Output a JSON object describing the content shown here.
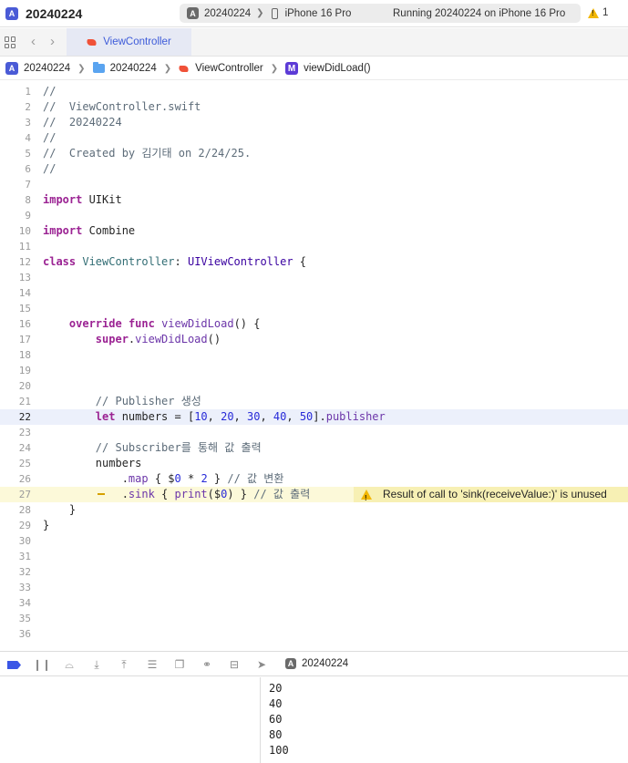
{
  "window": {
    "title": "20240224",
    "scheme": "20240224",
    "device": "iPhone 16 Pro",
    "status": "Running 20240224 on iPhone 16 Pro",
    "warning_count": "1"
  },
  "tabbar": {
    "back_glyph": "‹",
    "forward_glyph": "›",
    "active_tab": "ViewController"
  },
  "breadcrumb": {
    "project": "20240224",
    "group": "20240224",
    "file": "ViewController",
    "symbol": "viewDidLoad()",
    "symbol_badge": "M",
    "separator": "❯"
  },
  "editor": {
    "current_line": 22,
    "warning_line": 27,
    "warning_message": "Result of call to 'sink(receiveValue:)' is unused",
    "lines": [
      {
        "n": "1",
        "text": "//"
      },
      {
        "n": "2",
        "text": "//  ViewController.swift"
      },
      {
        "n": "3",
        "text": "//  20240224"
      },
      {
        "n": "4",
        "text": "//"
      },
      {
        "n": "5",
        "text": "//  Created by 김기태 on 2/24/25."
      },
      {
        "n": "6",
        "text": "//"
      },
      {
        "n": "7",
        "text": ""
      },
      {
        "n": "8",
        "text": "import UIKit"
      },
      {
        "n": "9",
        "text": ""
      },
      {
        "n": "10",
        "text": "import Combine"
      },
      {
        "n": "11",
        "text": ""
      },
      {
        "n": "12",
        "text": "class ViewController: UIViewController {"
      },
      {
        "n": "13",
        "text": ""
      },
      {
        "n": "14",
        "text": ""
      },
      {
        "n": "15",
        "text": ""
      },
      {
        "n": "16",
        "text": "    override func viewDidLoad() {"
      },
      {
        "n": "17",
        "text": "        super.viewDidLoad()"
      },
      {
        "n": "18",
        "text": ""
      },
      {
        "n": "19",
        "text": ""
      },
      {
        "n": "20",
        "text": ""
      },
      {
        "n": "21",
        "text": "        // Publisher 생성"
      },
      {
        "n": "22",
        "text": "        let numbers = [10, 20, 30, 40, 50].publisher"
      },
      {
        "n": "23",
        "text": ""
      },
      {
        "n": "24",
        "text": "        // Subscriber를 통해 값 출력"
      },
      {
        "n": "25",
        "text": "        numbers"
      },
      {
        "n": "26",
        "text": "            .map { $0 * 2 } // 값 변환"
      },
      {
        "n": "27",
        "text": "            .sink { print($0) } // 값 출력"
      },
      {
        "n": "28",
        "text": "    }"
      },
      {
        "n": "29",
        "text": "}"
      },
      {
        "n": "30",
        "text": ""
      },
      {
        "n": "31",
        "text": ""
      },
      {
        "n": "32",
        "text": ""
      },
      {
        "n": "33",
        "text": ""
      },
      {
        "n": "34",
        "text": ""
      },
      {
        "n": "35",
        "text": ""
      },
      {
        "n": "36",
        "text": ""
      }
    ]
  },
  "debug": {
    "scheme": "20240224",
    "icons": [
      "breakpoint-icon",
      "pause-icon",
      "step-over-icon",
      "step-into-icon",
      "step-out-icon",
      "view-hierarchy-icon",
      "memory-graph-icon",
      "environment-icon",
      "simulate-location-icon",
      "location-icon"
    ]
  },
  "console": {
    "output": [
      "20",
      "40",
      "60",
      "80",
      "100"
    ]
  },
  "colors": {
    "accent": "#3d5bd9",
    "keyword": "#9b2393",
    "comment": "#5d6c79",
    "type": "#3900a0",
    "warning": "#f2b705",
    "current_line_bg": "#ecf0fb",
    "warning_line_bg": "#fcf9d9"
  }
}
